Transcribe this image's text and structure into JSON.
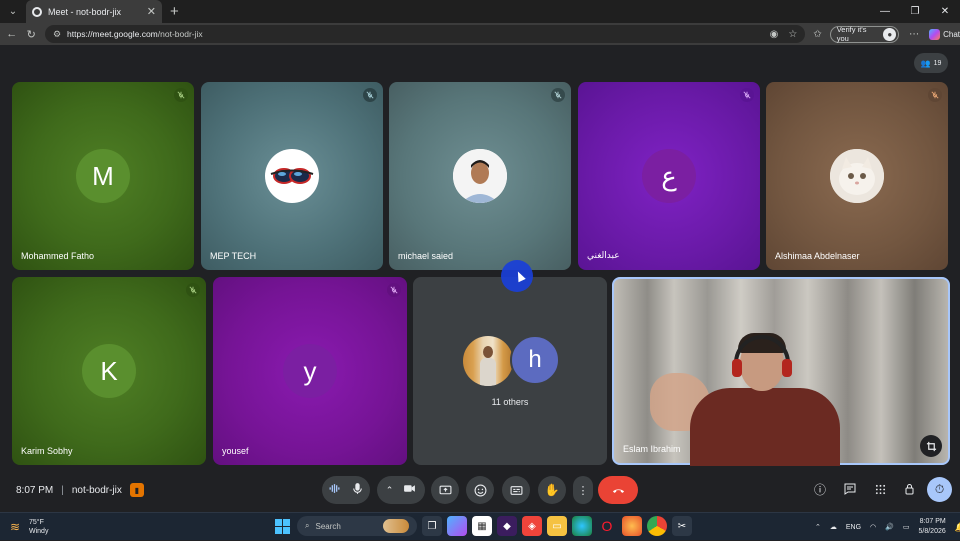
{
  "browser": {
    "tab_title": "Meet - not-bodr-jix",
    "url_host": "https://meet.google.com",
    "url_path": "/not-bodr-jix",
    "verify_label": "Verify it's you",
    "chat_label": "Chat"
  },
  "meet": {
    "participant_count": "19",
    "tiles": [
      {
        "name": "Mohammed Fatho",
        "avatar_letter": "M",
        "avatar_color": "#5a8f2e",
        "muted": true
      },
      {
        "name": "MEP TECH",
        "avatar_type": "photo-goggles",
        "muted": true
      },
      {
        "name": "michael saied",
        "avatar_type": "photo-person",
        "muted": true
      },
      {
        "name": "عبدالغني",
        "avatar_letter": "ع",
        "avatar_color": "#7b1fa2",
        "muted": true
      },
      {
        "name": "Alshimaa Abdelnaser",
        "avatar_type": "photo-cat",
        "muted": true
      },
      {
        "name": "Karim Sobhy",
        "avatar_letter": "K",
        "avatar_color": "#5a8f2e",
        "muted": true
      },
      {
        "name": "yousef",
        "avatar_letter": "y",
        "avatar_color": "#7b1fa2",
        "muted": true
      },
      {
        "name": "11 others",
        "avatar_letter": "h",
        "avatar_color": "#5c6bc0"
      },
      {
        "name": "Eslam Ibrahim",
        "avatar_type": "video"
      }
    ],
    "time": "8:07 PM",
    "meeting_code": "not-bodr-jix",
    "accent_leave": "#ea4335",
    "accent_active": "#a8c7fa"
  },
  "taskbar": {
    "weather_temp": "75°F",
    "weather_desc": "Windy",
    "weather_badge": "1",
    "search_label": "Search",
    "language": "ENG",
    "clock_time": "8:07 PM",
    "clock_date": "5/8/2026"
  }
}
